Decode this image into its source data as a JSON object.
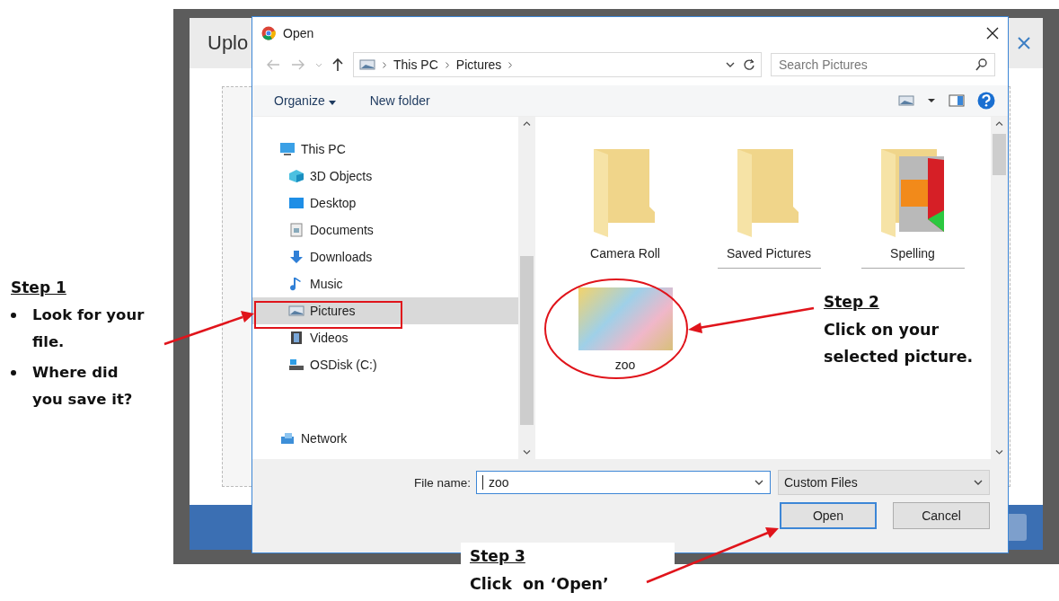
{
  "notes": {
    "step1": {
      "heading": "Step 1",
      "bullets": [
        "Look for your file.",
        "Where did you save it?"
      ]
    },
    "step2": {
      "heading": "Step 2",
      "text": "Click on your selected picture."
    },
    "step3": {
      "heading": "Step 3",
      "text": "Click  on ‘Open’"
    }
  },
  "background_dialog": {
    "title": "Uplo"
  },
  "dialog": {
    "title": "Open",
    "breadcrumbs": [
      "This PC",
      "Pictures"
    ],
    "search": {
      "placeholder": "Search Pictures"
    },
    "toolbar": [
      "Organize",
      "New folder"
    ],
    "nav": [
      {
        "label": "This PC",
        "kind": "pc",
        "selected": false,
        "children": [
          {
            "label": "3D Objects",
            "kind": "cube",
            "selected": false
          },
          {
            "label": "Desktop",
            "kind": "desktop",
            "selected": false
          },
          {
            "label": "Documents",
            "kind": "document",
            "selected": false
          },
          {
            "label": "Downloads",
            "kind": "download",
            "selected": false
          },
          {
            "label": "Music",
            "kind": "music",
            "selected": false
          },
          {
            "label": "Pictures",
            "kind": "pictures",
            "selected": true
          },
          {
            "label": "Videos",
            "kind": "video",
            "selected": false
          },
          {
            "label": "OSDisk (C:)",
            "kind": "disk",
            "selected": false
          }
        ]
      },
      {
        "label": "Network",
        "kind": "network",
        "selected": false
      }
    ],
    "files": [
      {
        "name": "Camera Roll",
        "kind": "folder"
      },
      {
        "name": "Saved Pictures",
        "kind": "folder"
      },
      {
        "name": "Spelling",
        "kind": "folder-preview"
      },
      {
        "name": "zoo",
        "kind": "image"
      }
    ],
    "file_name": {
      "label": "File name:",
      "value": "zoo"
    },
    "file_type": "Custom Files",
    "buttons": [
      {
        "label": "Open",
        "default": true
      },
      {
        "label": "Cancel",
        "default": false
      }
    ]
  }
}
